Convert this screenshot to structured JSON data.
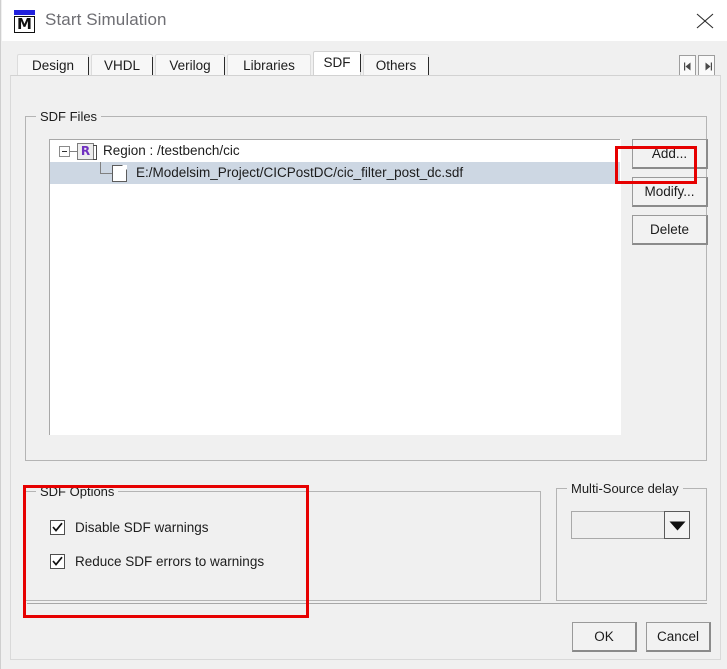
{
  "window": {
    "title": "Start Simulation",
    "app_icon": "modelsim-m-icon",
    "icon_letter": "M",
    "close_icon": "close-icon"
  },
  "tabs": {
    "items": [
      {
        "label": "Design",
        "selected": false
      },
      {
        "label": "VHDL",
        "selected": false
      },
      {
        "label": "Verilog",
        "selected": false
      },
      {
        "label": "Libraries",
        "selected": false
      },
      {
        "label": "SDF",
        "selected": true
      },
      {
        "label": "Others",
        "selected": false
      }
    ],
    "scroll_left_icon": "chevron-left-icon",
    "scroll_right_icon": "chevron-right-icon"
  },
  "sdf_files": {
    "group_title": "SDF Files",
    "tree": {
      "region": {
        "label": "Region : /testbench/cic",
        "icon": "region-r-icon",
        "icon_letter": "R",
        "expanded": true,
        "selected": false
      },
      "file": {
        "label": "E:/Modelsim_Project/CICPostDC/cic_filter_post_dc.sdf",
        "icon": "file-icon",
        "selected": true
      }
    },
    "buttons": {
      "add": "Add...",
      "modify": "Modify...",
      "delete": "Delete"
    }
  },
  "sdf_options": {
    "group_title": "SDF Options",
    "checkboxes": [
      {
        "label": "Disable SDF warnings",
        "checked": true
      },
      {
        "label": "Reduce SDF errors to warnings",
        "checked": true
      }
    ]
  },
  "multi_source": {
    "group_title": "Multi-Source delay",
    "value": "",
    "placeholder": "",
    "dropdown_icon": "caret-down-icon"
  },
  "footer": {
    "ok_label": "OK",
    "cancel_label": "Cancel"
  },
  "annotations": {
    "highlight_color": "#e60000",
    "regions": [
      {
        "name": "add-button-highlight"
      },
      {
        "name": "sdf-options-highlight"
      }
    ]
  },
  "colors": {
    "window_bg": "#f0f0f0",
    "titlebar_bg": "#ffffff",
    "selection": "#cdd7e3",
    "accent_blue": "#2222dd",
    "region_purple": "#7030c0"
  }
}
